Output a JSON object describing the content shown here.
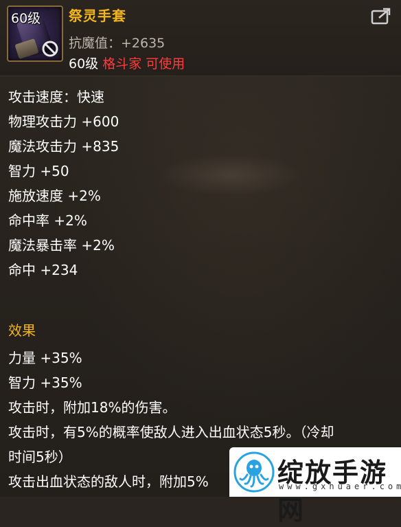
{
  "item": {
    "level_badge": "60级",
    "name": "祭灵手套",
    "resist": "抗魔值：+2635",
    "req_level": "60级",
    "req_class": "格斗家 可使用"
  },
  "stats": [
    "攻击速度：快速",
    "物理攻击力 +600",
    "魔法攻击力 +835",
    "智力 +50",
    "施放速度 +2%",
    "命中率 +2%",
    "魔法暴击率 +2%",
    "命中 +234"
  ],
  "effects": {
    "title": "效果",
    "lines": [
      "力量 +35%",
      "智力 +35%",
      "攻击时，附加18%的伤害。",
      "攻击时，有5%的概率使敌人进入出血状态5秒。（冷却",
      "时间5秒）",
      "攻击出血状态的敌人时，附加5%"
    ]
  },
  "watermark": {
    "name": "绽放手游网",
    "url": "www.gxhuaer.com"
  },
  "colors": {
    "name": "#f2b51c",
    "class_req": "#ff3b3b",
    "text": "#ffffff",
    "muted": "#bdb6ac"
  },
  "icons": {
    "item": "gloves-icon",
    "restriction": "prohibited-icon",
    "share": "share-icon",
    "watermark_logo": "octopus-logo-icon"
  }
}
